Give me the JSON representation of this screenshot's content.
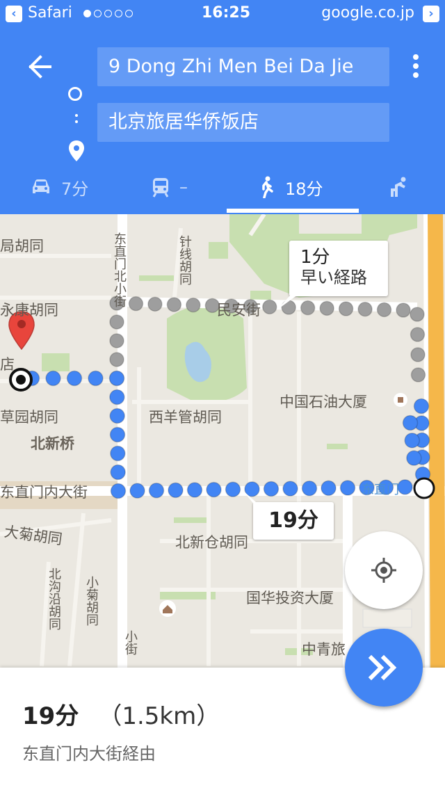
{
  "status_bar": {
    "app": "Safari",
    "time": "16:25",
    "domain": "google.co.jp",
    "signal_strength": 1,
    "signal_total": 5
  },
  "header": {
    "origin": "9 Dong Zhi Men Bei Da Jie",
    "destination": "北京旅居华侨饭店",
    "modes": [
      {
        "name": "car",
        "label": "7分",
        "icon": "car-icon"
      },
      {
        "name": "transit",
        "label": "–",
        "icon": "train-icon"
      },
      {
        "name": "walk",
        "label": "18分",
        "icon": "walk-icon",
        "active": true
      },
      {
        "name": "other",
        "label": "",
        "icon": "ride-icon"
      }
    ],
    "accent_color": "#4285f4"
  },
  "map": {
    "labels": {
      "l1": "局胡同",
      "l2": "永康胡同",
      "l3": "店",
      "l4": "草园胡同",
      "l5": "北新桥",
      "l6": "东直门内大街",
      "l7": "大菊胡同",
      "l8": "东直门北小街",
      "l9": "针线胡同",
      "l10": "民安街",
      "l11": "西羊管胡同",
      "l12": "中国石油大厦",
      "l13": "北新仓胡同",
      "l14": "国华投资大厦",
      "l15": "中青旅",
      "l16": "北沟沿胡同",
      "l17": "小菊胡同",
      "l18": "东直门",
      "l19": "小街"
    },
    "alt_route_callout": {
      "duration": "1分",
      "note": "早い経路"
    },
    "main_route_callout": {
      "duration": "19分"
    },
    "route_color": "#4285f4",
    "alt_route_color": "#9e9e9e"
  },
  "summary": {
    "duration": "19分",
    "distance": "（1.5km）",
    "via": "东直门内大街経由"
  }
}
